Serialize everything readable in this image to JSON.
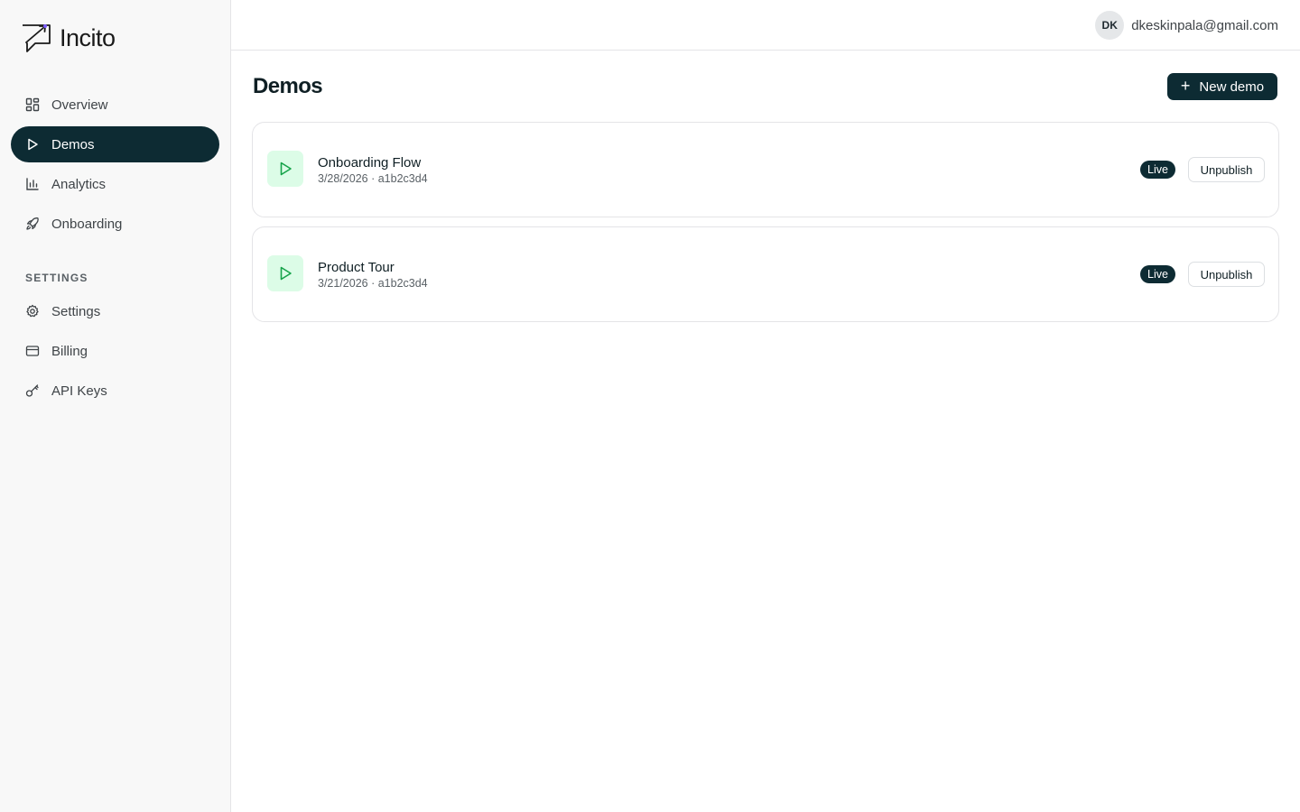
{
  "app": {
    "logo_text": "Incito"
  },
  "sidebar": {
    "items": [
      {
        "label": "Overview",
        "icon": "grid-icon",
        "active": false
      },
      {
        "label": "Demos",
        "icon": "play-icon",
        "active": true
      },
      {
        "label": "Analytics",
        "icon": "bar-chart-icon",
        "active": false
      },
      {
        "label": "Onboarding",
        "icon": "rocket-icon",
        "active": false
      }
    ],
    "section_label": "SETTINGS",
    "settings_items": [
      {
        "label": "Settings",
        "icon": "gear-icon"
      },
      {
        "label": "Billing",
        "icon": "credit-card-icon"
      },
      {
        "label": "API Keys",
        "icon": "key-icon"
      }
    ]
  },
  "header": {
    "avatar_initials": "DK",
    "email": "dkeskinpala@gmail.com"
  },
  "main": {
    "title": "Demos",
    "new_button_label": "New demo",
    "demos": [
      {
        "title": "Onboarding Flow",
        "meta": "3/28/2026 · a1b2c3d4",
        "status": "Live",
        "action": "Unpublish"
      },
      {
        "title": "Product Tour",
        "meta": "3/21/2026 · a1b2c3d4",
        "status": "Live",
        "action": "Unpublish"
      }
    ]
  },
  "colors": {
    "primary": "#0d2b33",
    "sidebar_bg": "#f8f8f8",
    "icon_bg": "#dcfce7",
    "icon_green": "#16a34a"
  }
}
